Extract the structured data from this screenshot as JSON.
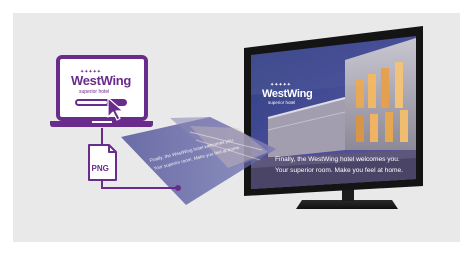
{
  "brand": {
    "name": "WestWing",
    "tagline": "superior hotel",
    "stars": "✦✦✦✦✦",
    "accent_color": "#6a2c8c"
  },
  "file_icon": {
    "label": "PNG"
  },
  "tv_screen": {
    "message": "Finally, the WestWing hotel welcomes you. Your superior room. Make you feel at home."
  },
  "icons": [
    "laptop-icon",
    "cursor-icon",
    "file-png-icon",
    "tv-icon"
  ]
}
